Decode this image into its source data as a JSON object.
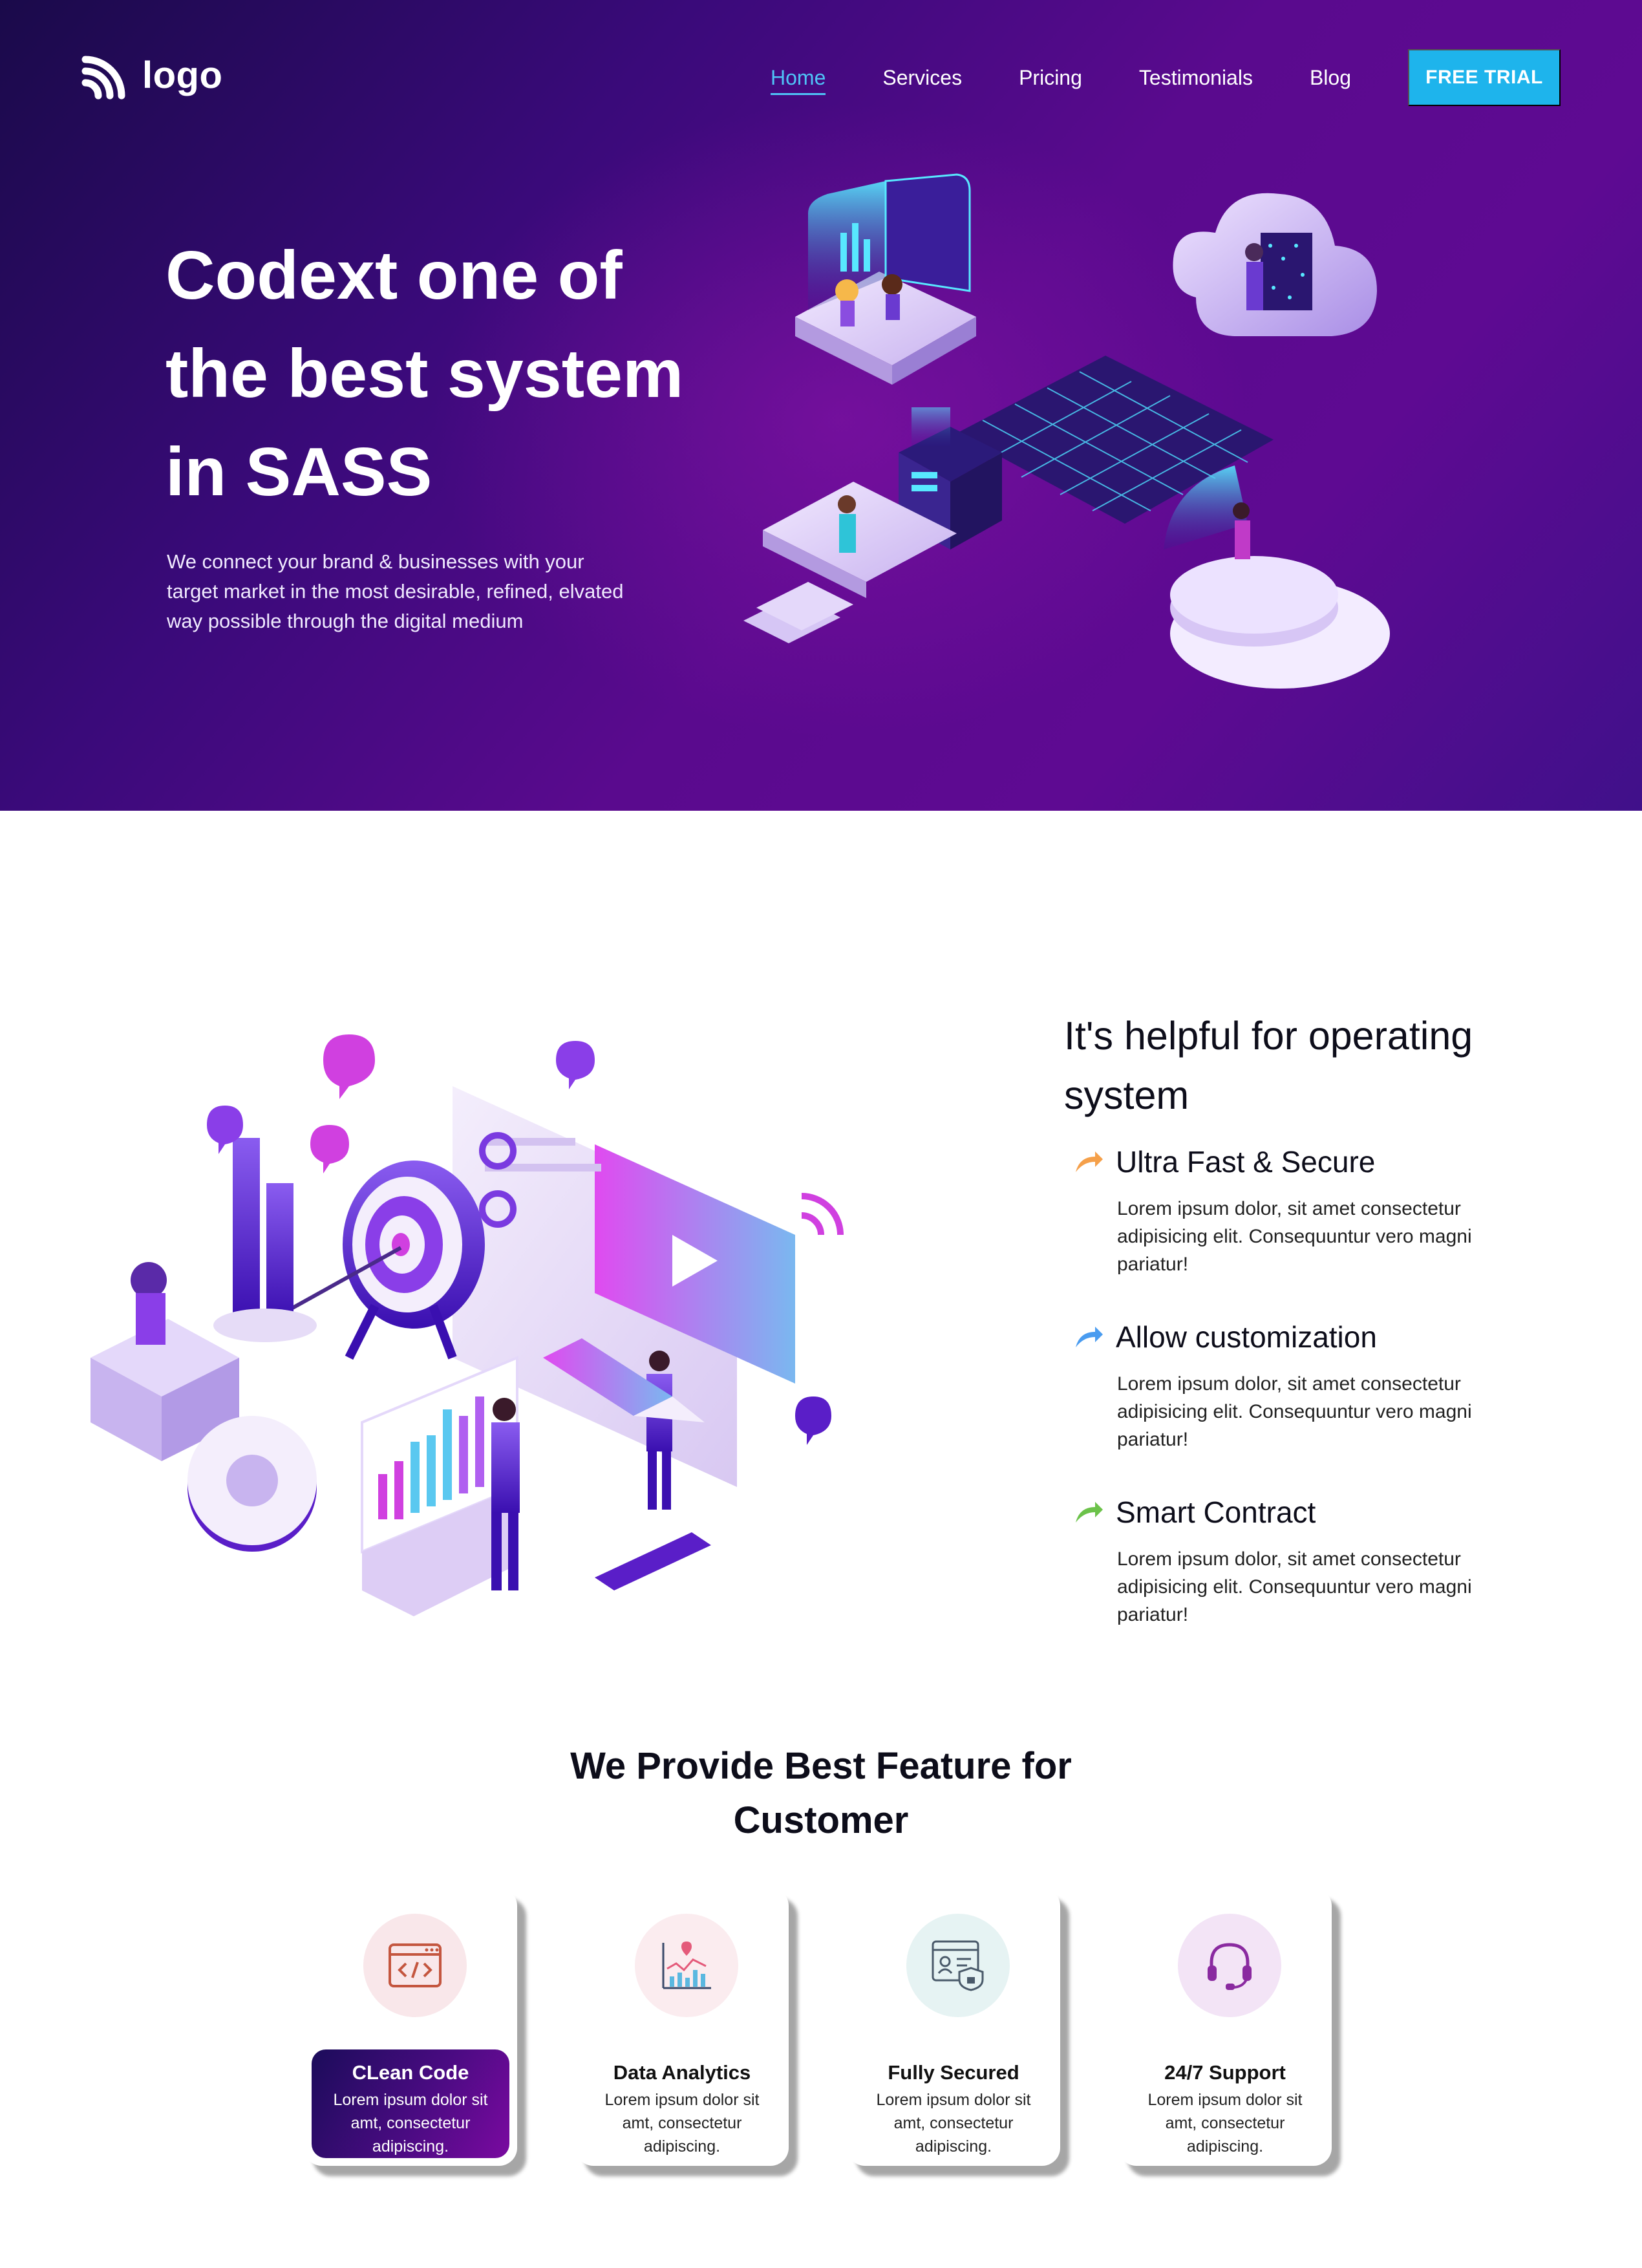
{
  "brand": {
    "logo_text": "logo",
    "accent": "#1eb4ec",
    "hero_gradient": [
      "#1a0a4a",
      "#5e0a92"
    ]
  },
  "nav": {
    "items": [
      {
        "label": "Home",
        "active": true
      },
      {
        "label": "Services",
        "active": false
      },
      {
        "label": "Pricing",
        "active": false
      },
      {
        "label": "Testimonials",
        "active": false
      },
      {
        "label": "Blog",
        "active": false
      }
    ],
    "cta": "FREE TRIAL"
  },
  "hero": {
    "title_lines": [
      "Codext one of",
      "the best system",
      "in SASS"
    ],
    "subtitle_lines": [
      "We connect your brand & businesses with your",
      "target market in the most desirable, refined, elvated",
      "way possible through the digital medium"
    ]
  },
  "helpful": {
    "title_lines": [
      "It's helpful for operating",
      "system"
    ],
    "items": [
      {
        "name": "Ultra Fast & Secure",
        "arrow_color": "#f5a04a",
        "desc_lines": [
          "Lorem ipsum dolor, sit amet consectetur",
          "adipisicing elit. Consequuntur vero magni",
          "pariatur!"
        ]
      },
      {
        "name": "Allow customization",
        "arrow_color": "#4a9cf0",
        "desc_lines": [
          "Lorem ipsum dolor, sit amet consectetur",
          "adipisicing elit. Consequuntur vero magni",
          "pariatur!"
        ]
      },
      {
        "name": "Smart Contract",
        "arrow_color": "#6cc24a",
        "desc_lines": [
          "Lorem ipsum dolor, sit amet consectetur",
          "adipisicing elit. Consequuntur vero magni",
          "pariatur!"
        ]
      }
    ]
  },
  "features": {
    "title_lines": [
      "We Provide Best Feature for",
      "Customer"
    ],
    "cards": [
      {
        "name": "CLean Code",
        "icon": "code-window-icon",
        "circle_color": "#f9e7ea",
        "active": true,
        "desc_lines": [
          "Lorem ipsum dolor sit",
          "amt, consectetur",
          "adipiscing."
        ]
      },
      {
        "name": "Data Analytics",
        "icon": "analytics-chart-icon",
        "circle_color": "#fbecef",
        "active": false,
        "desc_lines": [
          "Lorem ipsum dolor sit",
          "amt, consectetur",
          "adipiscing."
        ]
      },
      {
        "name": "Fully Secured",
        "icon": "secure-profile-icon",
        "circle_color": "#e6f3f3",
        "active": false,
        "desc_lines": [
          "Lorem ipsum dolor sit",
          "amt, consectetur",
          "adipiscing."
        ]
      },
      {
        "name": "24/7 Support",
        "icon": "headset-icon",
        "circle_color": "#f3e4f6",
        "active": false,
        "desc_lines": [
          "Lorem ipsum dolor sit",
          "amt, consectetur",
          "adipiscing."
        ]
      }
    ]
  }
}
